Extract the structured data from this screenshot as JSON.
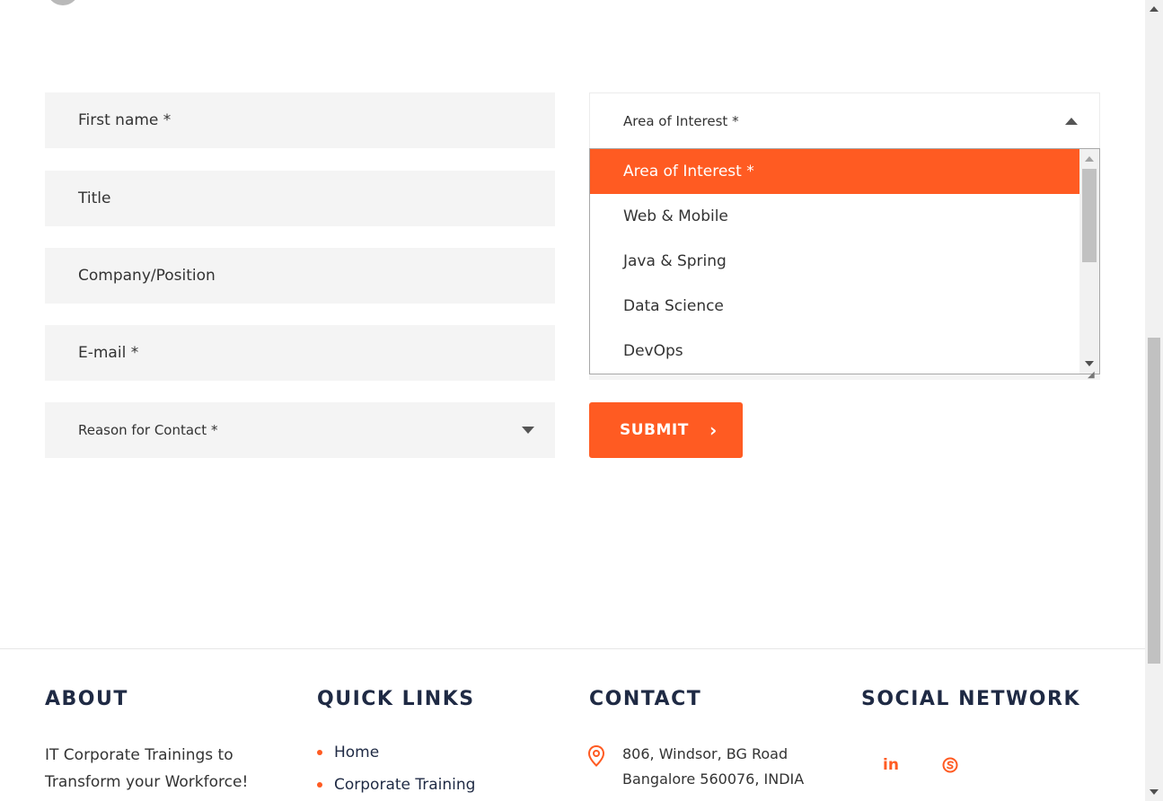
{
  "form": {
    "first_name_placeholder": "First name *",
    "title_placeholder": "Title",
    "company_placeholder": "Company/Position",
    "email_placeholder": "E-mail *",
    "reason_label": "Reason for Contact *",
    "area_label": "Area of Interest *",
    "area_options": [
      "Area of Interest *",
      "Web & Mobile",
      "Java & Spring",
      "Data Science",
      "DevOps"
    ],
    "submit_label": "SUBMIT",
    "submit_icon": "chevron-right-icon"
  },
  "footer": {
    "about": {
      "heading": "ABOUT",
      "text": "IT Corporate Trainings to Transform your Workforce!"
    },
    "quick_links": {
      "heading": "QUICK LINKS",
      "items": [
        "Home",
        "Corporate Training"
      ]
    },
    "contact": {
      "heading": "CONTACT",
      "address_line1": "806, Windsor, BG Road",
      "address_line2": "Bangalore 560076, INDIA",
      "icon": "location-pin-icon"
    },
    "social": {
      "heading": "SOCIAL NETWORK",
      "icons": [
        "linkedin-icon",
        "skype-icon"
      ],
      "linkedin_glyph": "in"
    }
  },
  "colors": {
    "accent": "#ff5b22",
    "field_bg": "#f4f4f4",
    "heading": "#1f2a44"
  }
}
